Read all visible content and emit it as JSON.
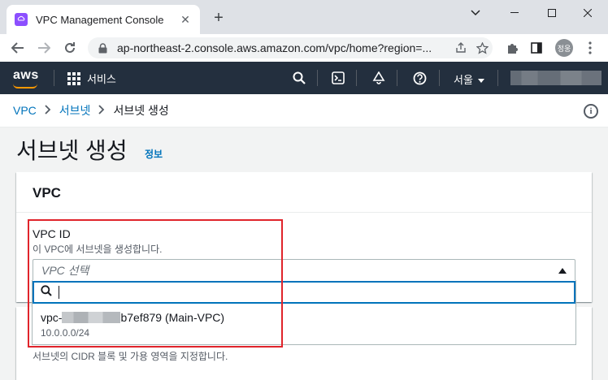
{
  "browser": {
    "tab_title": "VPC Management Console",
    "tab_close": "✕",
    "new_tab": "+",
    "url": "ap-northeast-2.console.aws.amazon.com/vpc/home?region=...",
    "profile_initials": "정웅"
  },
  "aws_header": {
    "logo": "aws",
    "services_label": "서비스",
    "region_label": "서울"
  },
  "breadcrumb": {
    "items": [
      "VPC",
      "서브넷"
    ],
    "current": "서브넷 생성"
  },
  "page": {
    "title": "서브넷 생성",
    "info_link": "정보"
  },
  "vpc_card": {
    "header": "VPC",
    "field_label": "VPC ID",
    "field_description": "이 VPC에 서브넷을 생성합니다.",
    "select_placeholder": "VPC 선택",
    "option_prefix": "vpc-",
    "option_suffix": "b7ef879 (Main-VPC)",
    "option_cidr": "10.0.0.0/24"
  },
  "subnet_card": {
    "cidr_description": "서브넷의 CIDR 블록 및 가용 영역을 지정합니다."
  },
  "colors": {
    "aws_header_bg": "#232f3e",
    "link_blue": "#0073bb",
    "aws_orange": "#ff9900",
    "annotation_red": "#e0242b"
  }
}
